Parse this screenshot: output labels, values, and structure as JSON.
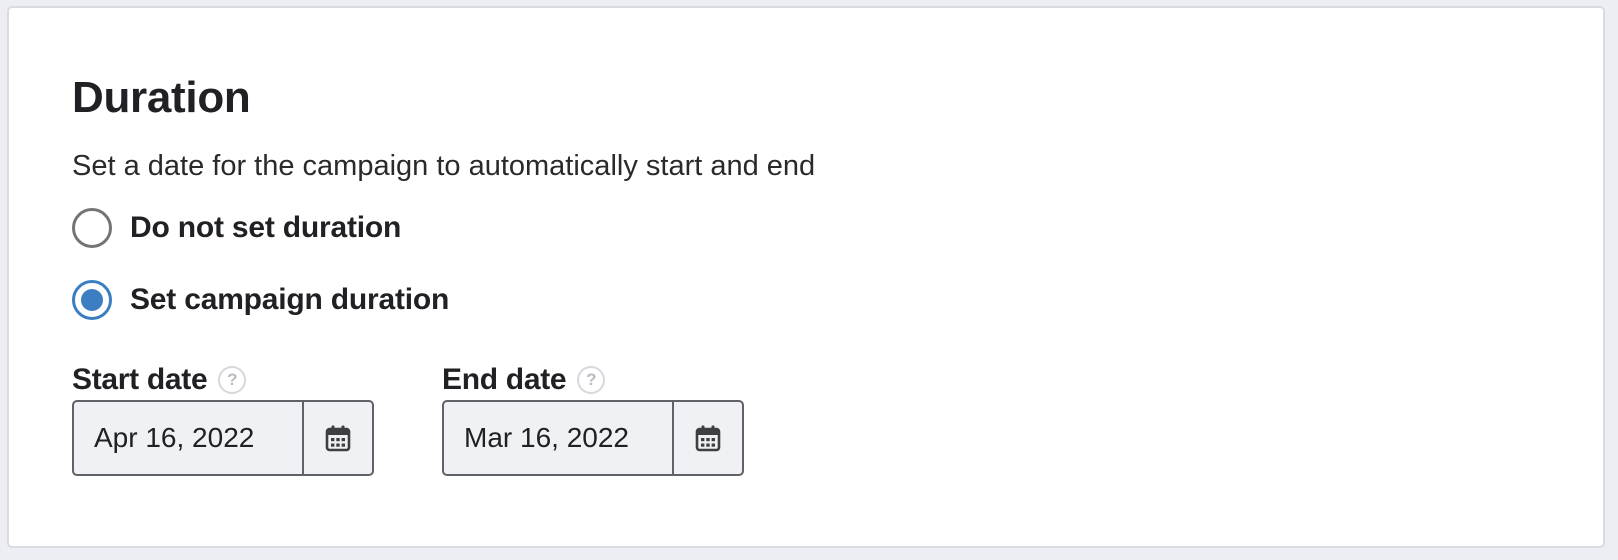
{
  "section": {
    "title": "Duration",
    "description": "Set a date for the campaign to automatically start and end"
  },
  "options": [
    {
      "label": "Do not set duration",
      "selected": false
    },
    {
      "label": "Set campaign duration",
      "selected": true
    }
  ],
  "fields": {
    "start": {
      "label": "Start date",
      "value": "Apr 16, 2022",
      "help_glyph": "?"
    },
    "end": {
      "label": "End date",
      "value": "Mar 16, 2022",
      "help_glyph": "?"
    }
  },
  "colors": {
    "accent": "#3b7ec2",
    "input_bg": "#f0f1f5",
    "border": "#5f6368"
  },
  "icons": {
    "calendar": "calendar-icon",
    "help": "help-icon"
  }
}
